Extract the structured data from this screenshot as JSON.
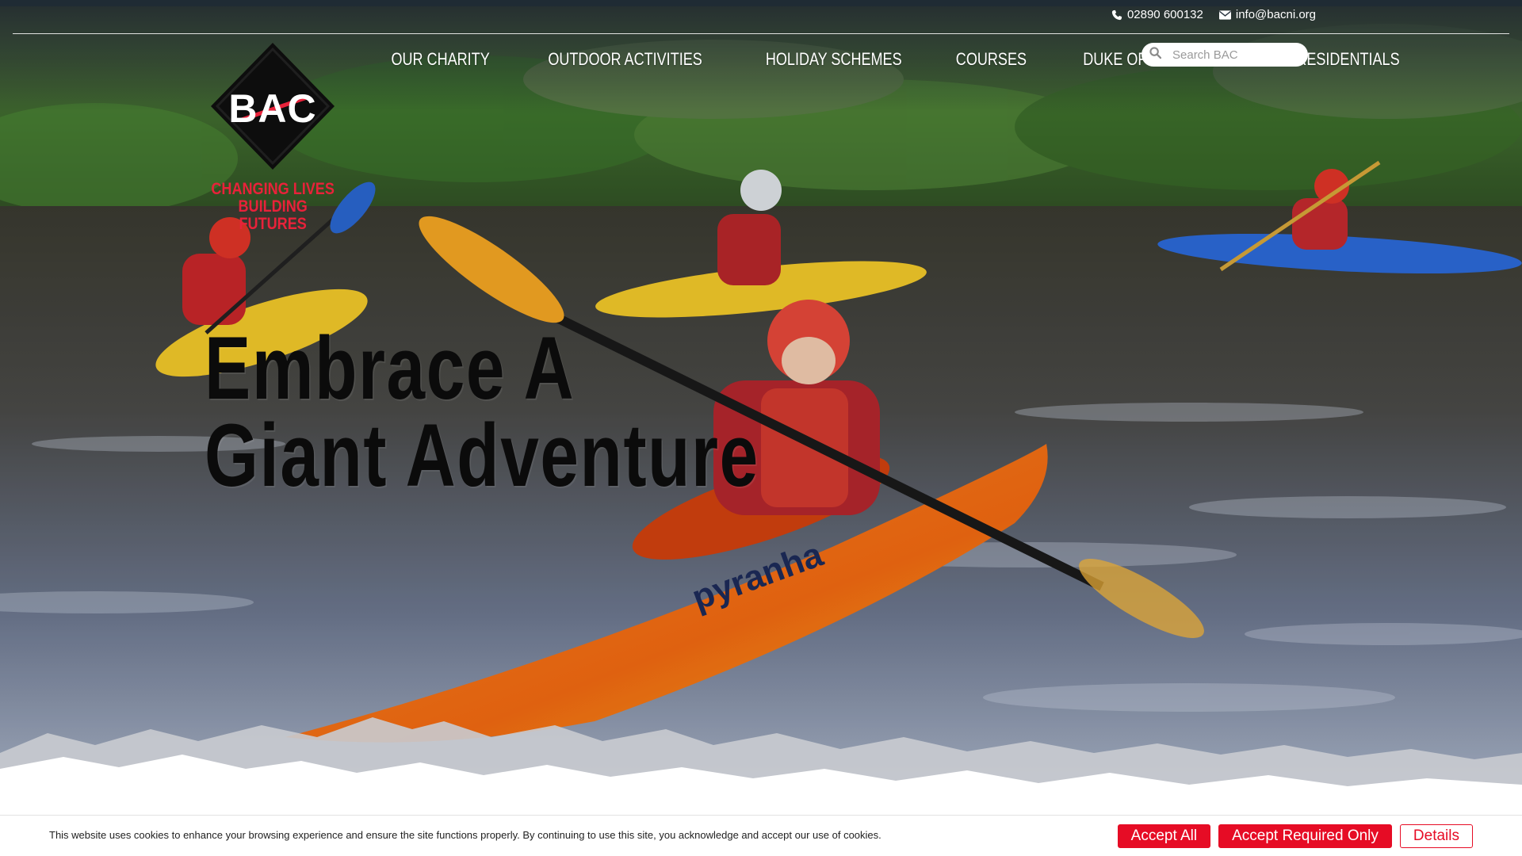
{
  "topbar": {
    "phone": "02890 600132",
    "email": "info@bacni.org"
  },
  "logo": {
    "letters": "BAC",
    "tagline_line1": "CHANGING LIVES",
    "tagline_line2": "BUILDING FUTURES"
  },
  "nav": {
    "items": [
      {
        "label": "OUR CHARITY"
      },
      {
        "label": "OUTDOOR ACTIVITIES"
      },
      {
        "label": "HOLIDAY SCHEMES"
      },
      {
        "label": "COURSES"
      },
      {
        "label": "DUKE OF EDINBURGH"
      },
      {
        "label": "RESIDENTIALS"
      }
    ]
  },
  "search": {
    "placeholder": "Search BAC"
  },
  "hero": {
    "headline_line1": "Embrace A",
    "headline_line2": "Giant Adventure",
    "kayak_brand": "pyranha"
  },
  "cookie": {
    "text": "This website uses cookies to enhance your browsing experience and ensure the site functions properly. By continuing to use this site, you acknowledge and accept our use of cookies.",
    "accept_all": "Accept All",
    "accept_required": "Accept Required Only",
    "details": "Details"
  },
  "colors": {
    "brand_red": "#e60c25",
    "topbar": "#1e2a35",
    "headline": "#0b0b0b"
  },
  "icons": {
    "phone": "phone-icon",
    "email": "envelope-icon",
    "search": "search-icon"
  }
}
